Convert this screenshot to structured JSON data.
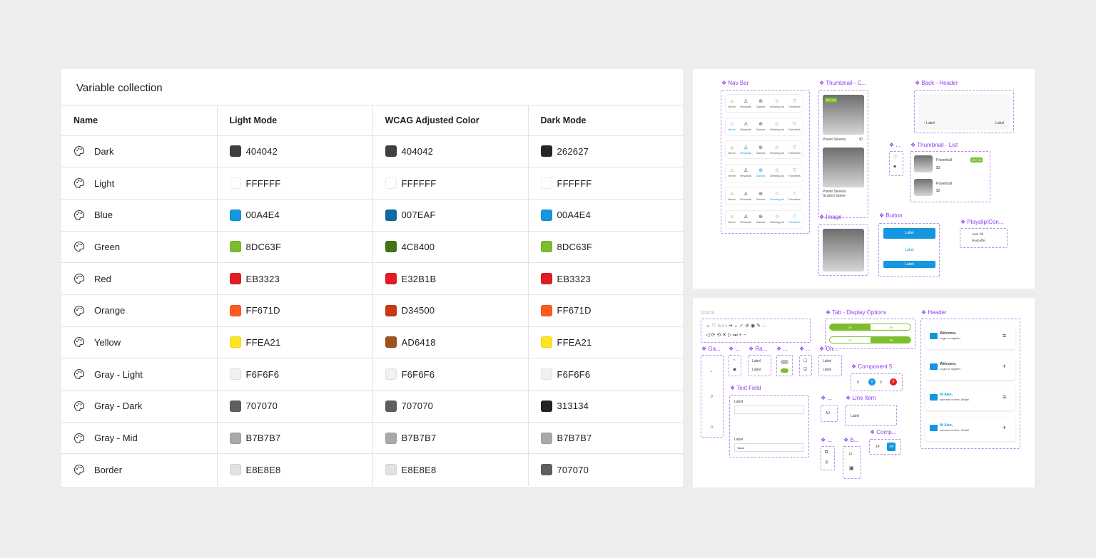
{
  "variable_collection": {
    "title": "Variable collection",
    "columns": [
      "Name",
      "Light Mode",
      "WCAG Adjusted Color",
      "Dark Mode"
    ],
    "rows": [
      {
        "name": "Dark",
        "light": "404042",
        "wcag": "404042",
        "dark": "262627",
        "light_hex": "#404042",
        "wcag_hex": "#404042",
        "dark_hex": "#262627"
      },
      {
        "name": "Light",
        "light": "FFFFFF",
        "wcag": "FFFFFF",
        "dark": "FFFFFF",
        "light_hex": "#FFFFFF",
        "wcag_hex": "#FFFFFF",
        "dark_hex": "#FFFFFF"
      },
      {
        "name": "Blue",
        "light": "00A4E4",
        "wcag": "007EAF",
        "dark": "00A4E4",
        "light_hex": "#1596de",
        "wcag_hex": "#0f6aa3",
        "dark_hex": "#1596de"
      },
      {
        "name": "Green",
        "light": "8DC63F",
        "wcag": "4C8400",
        "dark": "8DC63F",
        "light_hex": "#7cbd2f",
        "wcag_hex": "#3f7516",
        "dark_hex": "#7cbd2f"
      },
      {
        "name": "Red",
        "light": "EB3323",
        "wcag": "E32B1B",
        "dark": "EB3323",
        "light_hex": "#e31b23",
        "wcag_hex": "#e31b23",
        "dark_hex": "#e31b23"
      },
      {
        "name": "Orange",
        "light": "FF671D",
        "wcag": "D34500",
        "dark": "FF671D",
        "light_hex": "#ff5a1f",
        "wcag_hex": "#c93a10",
        "dark_hex": "#ff5a1f"
      },
      {
        "name": "Yellow",
        "light": "FFEA21",
        "wcag": "AD6418",
        "dark": "FFEA21",
        "light_hex": "#fde621",
        "wcag_hex": "#a0521c",
        "dark_hex": "#fde621"
      },
      {
        "name": "Gray - Light",
        "light": "F6F6F6",
        "wcag": "F6F6F6",
        "dark": "F6F6F6",
        "light_hex": "#f1f1f1",
        "wcag_hex": "#f1f1f1",
        "dark_hex": "#f1f1f1"
      },
      {
        "name": "Gray - Dark",
        "light": "707070",
        "wcag": "707070",
        "dark": "313134",
        "light_hex": "#5f5f61",
        "wcag_hex": "#5f5f61",
        "dark_hex": "#232325"
      },
      {
        "name": "Gray - Mid",
        "light": "B7B7B7",
        "wcag": "B7B7B7",
        "dark": "B7B7B7",
        "light_hex": "#a9a9a9",
        "wcag_hex": "#a9a9a9",
        "dark_hex": "#a9a9a9"
      },
      {
        "name": "Border",
        "light": "E8E8E8",
        "wcag": "E8E8E8",
        "dark": "707070",
        "light_hex": "#e2e2e2",
        "wcag_hex": "#e2e2e2",
        "dark_hex": "#5f5f61"
      }
    ]
  },
  "components_top": {
    "nav_bar": "❖ Nav Bar",
    "nav_items": [
      "Home",
      "Rewards",
      "Games",
      "Winning #s",
      "Favorites"
    ],
    "thumbnail_c": "❖ Thumbnail - C...",
    "back_header": "❖ Back - Header",
    "back_header_back": "‹  Label",
    "back_header_right": "Label",
    "dots1": "❖ ...",
    "thumbnail_list": "❖ Thumbnail - List",
    "image": "❖ Image",
    "button": "❖ Button",
    "playslip": "❖ Playslip/Con...",
    "button_label": "Label",
    "power_sevens": "Power Sevens",
    "scratch_game": "Scratch Game",
    "price": "$7",
    "powerball": "Powerball",
    "price3": "$3",
    "badge": "$77,1M",
    "auto_fill": "Auto Fill",
    "bet_shuffle": "Reshuffle"
  },
  "components_bottom": {
    "icons": "Icons",
    "tab_display": "❖ Tab - Display Options",
    "header": "❖ Header",
    "ga": "❖ Ga...",
    "ra": "❖ Ra...",
    "d2": "❖ ...",
    "d3": "❖ ...",
    "ch": "❖ Ch...",
    "component5": "❖ Component 5",
    "text_field": "❖ Text Field",
    "d4": "❖ ...",
    "line_item": "❖ Line Item",
    "d5": "❖ ...",
    "b": "❖ B...",
    "comp": "❖ Comp...",
    "welcome": "Welcome,",
    "login": "Login or register",
    "hi_alex": "Hi Alex,",
    "summer": "summer is here. Woah!",
    "label": "Label",
    "value": "Value",
    "tab_on": "On",
    "tab_off": "Off",
    "aj": "AJ",
    "n14a": "14",
    "n14b": "14",
    "c0": "0",
    "c1": "0",
    "c2": "0",
    "c3": "0",
    "g1": "0",
    "g2": "0"
  }
}
